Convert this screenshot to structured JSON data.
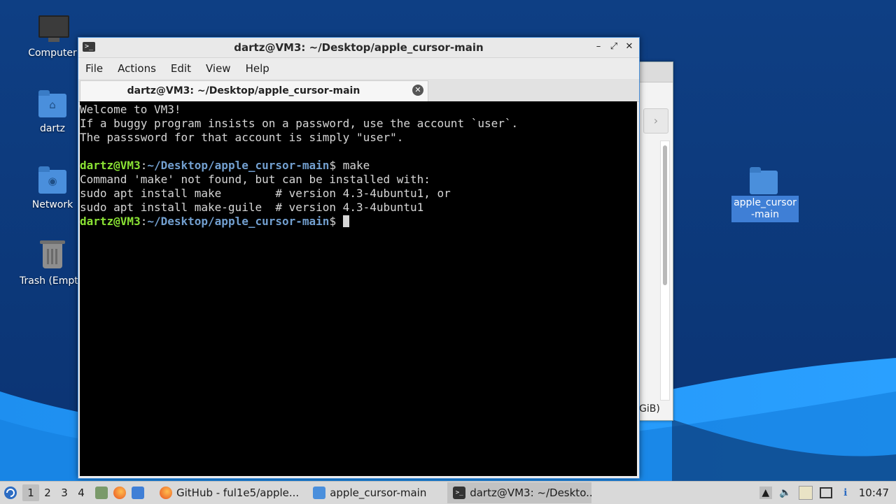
{
  "desktop": {
    "icons": [
      {
        "label": "Computer",
        "icon": "computer-icon"
      },
      {
        "label": "dartz",
        "icon": "home-folder-icon"
      },
      {
        "label": "Network",
        "icon": "network-folder-icon"
      },
      {
        "label": "Trash (Empt",
        "icon": "trash-icon"
      }
    ],
    "right_icon": {
      "label": "apple_cursor-main",
      "icon": "folder-icon"
    }
  },
  "background_window": {
    "status_fragment": "GiB)"
  },
  "terminal": {
    "title": "dartz@VM3: ~/Desktop/apple_cursor-main",
    "menu": [
      "File",
      "Actions",
      "Edit",
      "View",
      "Help"
    ],
    "tab_title": "dartz@VM3: ~/Desktop/apple_cursor-main",
    "lines": {
      "l1": "Welcome to VM3!",
      "l2": "If a buggy program insists on a password, use the account `user`.",
      "l3": "The passsword for that account is simply \"user\".",
      "prompt_user": "dartz@VM3",
      "prompt_sep": ":",
      "prompt_path": "~/Desktop/apple_cursor-main",
      "prompt_dollar": "$ ",
      "cmd1": "make",
      "l5": "Command 'make' not found, but can be installed with:",
      "l6": "sudo apt install make        # version 4.3-4ubuntu1, or",
      "l7": "sudo apt install make-guile  # version 4.3-4ubuntu1"
    }
  },
  "taskbar": {
    "workspaces": [
      "1",
      "2",
      "3",
      "4"
    ],
    "active_workspace": "1",
    "apps": [
      {
        "label": "GitHub - ful1e5/apple...",
        "icon": "firefox-icon"
      },
      {
        "label": "apple_cursor-main",
        "icon": "folder-icon"
      },
      {
        "label": "dartz@VM3: ~/Deskto...",
        "icon": "terminal-icon"
      }
    ],
    "clock": "10:47"
  },
  "colors": {
    "prompt_user": "#8ae234",
    "prompt_path": "#729fcf",
    "accent": "#4a90d9"
  }
}
